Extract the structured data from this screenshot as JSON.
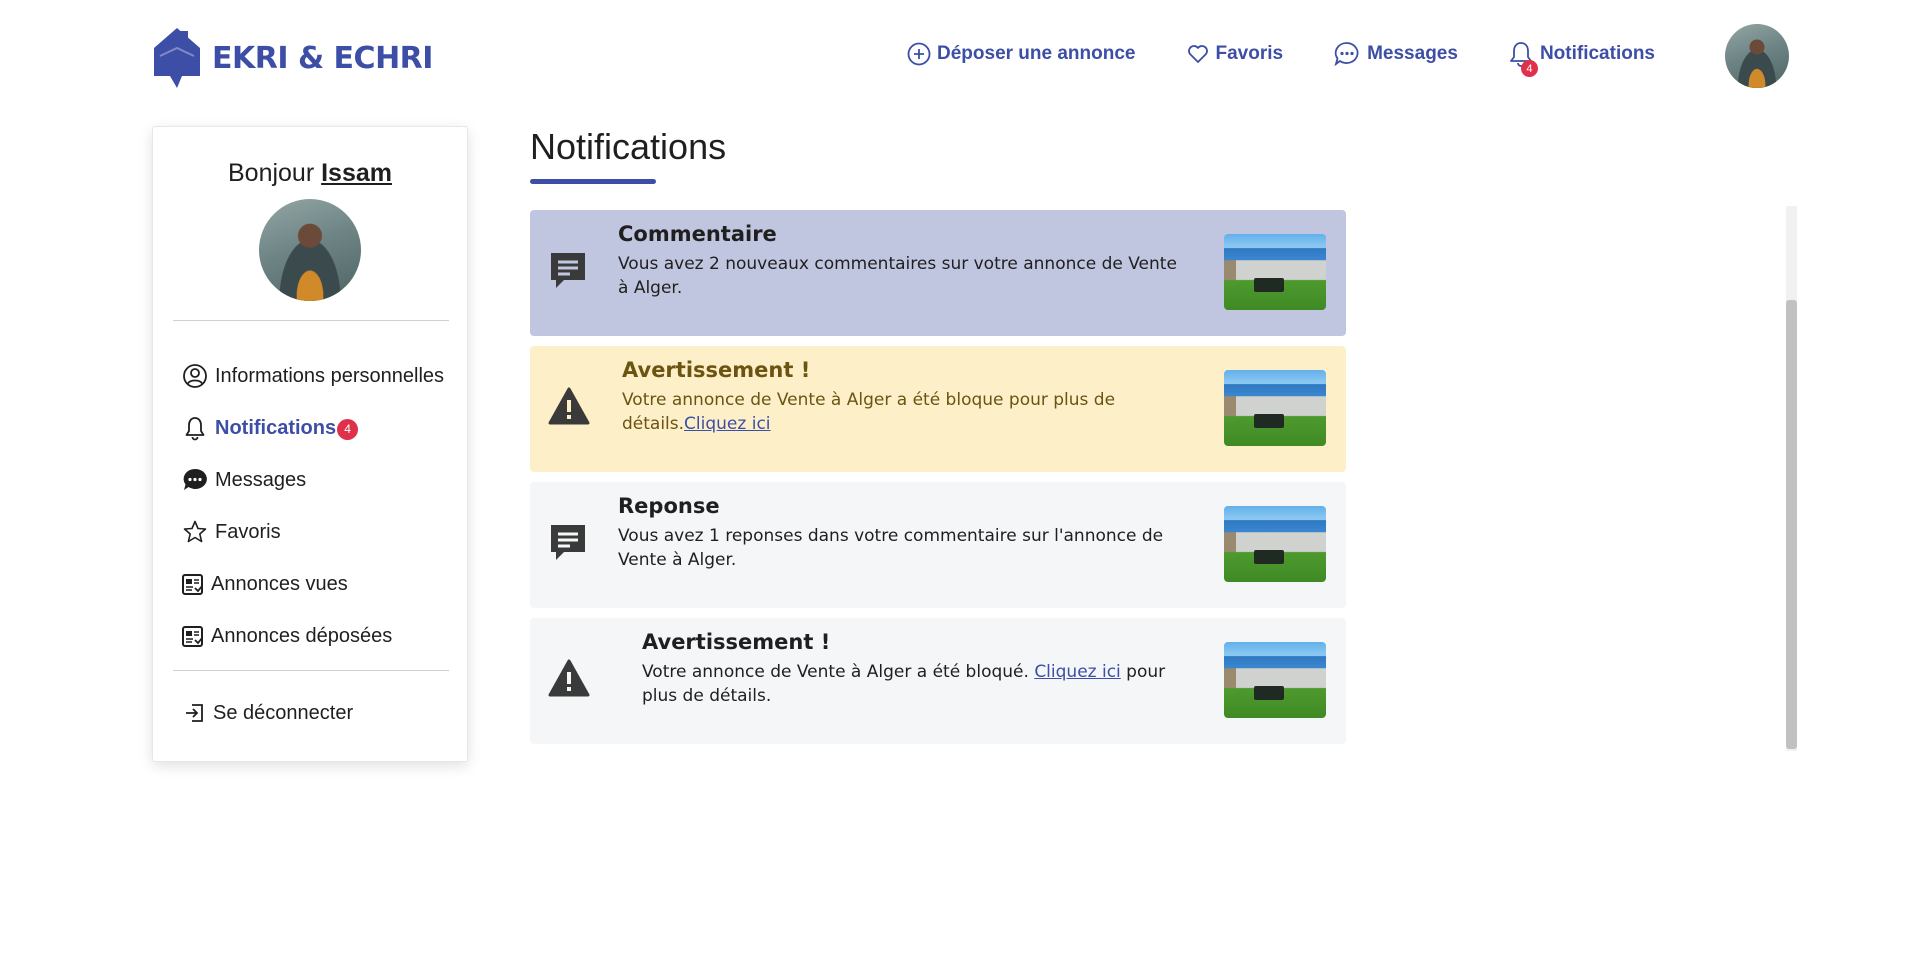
{
  "brand": {
    "name": "EKRI & ECHRI"
  },
  "nav": {
    "post_ad": "Déposer une annonce",
    "favorites": "Favoris",
    "messages": "Messages",
    "notifications": "Notifications",
    "notifications_count": "4"
  },
  "sidebar": {
    "greeting": "Bonjour",
    "username": "Issam",
    "items": [
      {
        "label": "Informations personnelles",
        "icon": "user-circle-icon"
      },
      {
        "label": "Notifications",
        "icon": "bell-icon",
        "badge": "4",
        "active": true
      },
      {
        "label": "Messages",
        "icon": "chat-bubble-icon"
      },
      {
        "label": "Favoris",
        "icon": "star-icon"
      },
      {
        "label": "Annonces vues",
        "icon": "ad-card-icon"
      },
      {
        "label": "Annonces déposées",
        "icon": "ad-card-icon"
      }
    ],
    "logout": "Se déconnecter"
  },
  "main": {
    "title": "Notifications",
    "notifications": [
      {
        "type": "comment",
        "title": "Commentaire",
        "text": "Vous avez 2 nouveaux commentaires sur votre annonce de Vente à Alger."
      },
      {
        "type": "warning",
        "title": "Avertissement !",
        "text_before": "Votre annonce de Vente à Alger a été bloque pour plus de détails.",
        "link": "Cliquez ici",
        "text_after": ""
      },
      {
        "type": "reply",
        "title": "Reponse",
        "text": "Vous avez 1 reponses dans votre commentaire sur l'annonce de Vente à Alger."
      },
      {
        "type": "warning",
        "title": "Avertissement !",
        "text_before": "Votre annonce de Vente à Alger a été bloqué. ",
        "link": "Cliquez ici",
        "text_after": " pour plus de détails."
      }
    ]
  },
  "colors": {
    "brand": "#3d4ea6",
    "badge": "#e0314b",
    "comment_unread_bg": "#c1c6e0",
    "warning_unread_bg": "#fdf0c9",
    "read_bg": "#f4f6f7"
  }
}
